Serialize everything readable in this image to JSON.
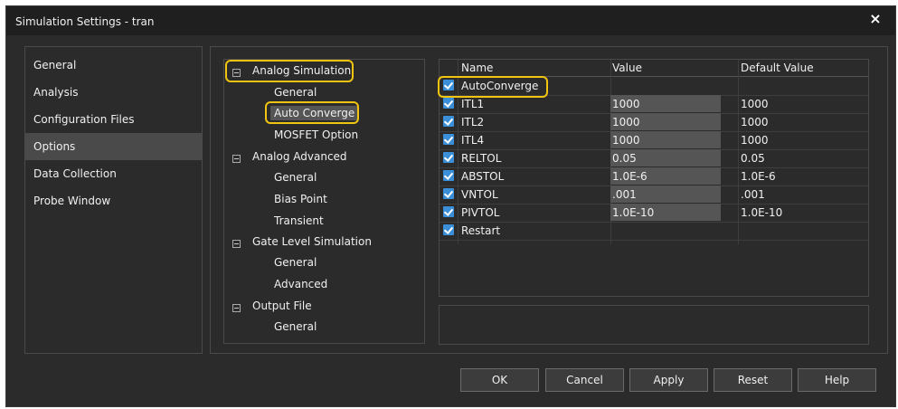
{
  "window": {
    "title": "Simulation Settings - tran",
    "close_icon": "×"
  },
  "left_nav": {
    "items": [
      {
        "label": "General"
      },
      {
        "label": "Analysis"
      },
      {
        "label": "Configuration Files"
      },
      {
        "label": "Options",
        "selected": true
      },
      {
        "label": "Data Collection"
      },
      {
        "label": "Probe Window"
      }
    ]
  },
  "tree": {
    "groups": [
      {
        "label": "Analog Simulation",
        "children": [
          "General",
          "Auto Converge",
          "MOSFET Option"
        ]
      },
      {
        "label": "Analog Advanced",
        "children": [
          "General",
          "Bias Point",
          "Transient"
        ]
      },
      {
        "label": "Gate Level Simulation",
        "children": [
          "General",
          "Advanced"
        ]
      },
      {
        "label": "Output File",
        "children": [
          "General"
        ]
      }
    ],
    "selected": "Auto Converge"
  },
  "grid": {
    "headers": {
      "name": "Name",
      "value": "Value",
      "default": "Default Value"
    },
    "rows": [
      {
        "name": "AutoConverge",
        "value": "",
        "default": "",
        "checked": true
      },
      {
        "name": "ITL1",
        "value": "1000",
        "default": "1000",
        "checked": true
      },
      {
        "name": "ITL2",
        "value": "1000",
        "default": "1000",
        "checked": true
      },
      {
        "name": "ITL4",
        "value": "1000",
        "default": "1000",
        "checked": true
      },
      {
        "name": "RELTOL",
        "value": "0.05",
        "default": "0.05",
        "checked": true
      },
      {
        "name": "ABSTOL",
        "value": "1.0E-6",
        "default": "1.0E-6",
        "checked": true
      },
      {
        "name": "VNTOL",
        "value": ".001",
        "default": ".001",
        "checked": true
      },
      {
        "name": "PIVTOL",
        "value": "1.0E-10",
        "default": "1.0E-10",
        "checked": true
      },
      {
        "name": "Restart",
        "value": "",
        "default": "",
        "checked": true
      }
    ]
  },
  "buttons": {
    "ok": "OK",
    "cancel": "Cancel",
    "apply": "Apply",
    "reset": "Reset",
    "help": "Help"
  },
  "colors": {
    "highlight": "#f1c40f",
    "checkbox": "#3a8fd8",
    "background": "#2b2b2b"
  }
}
